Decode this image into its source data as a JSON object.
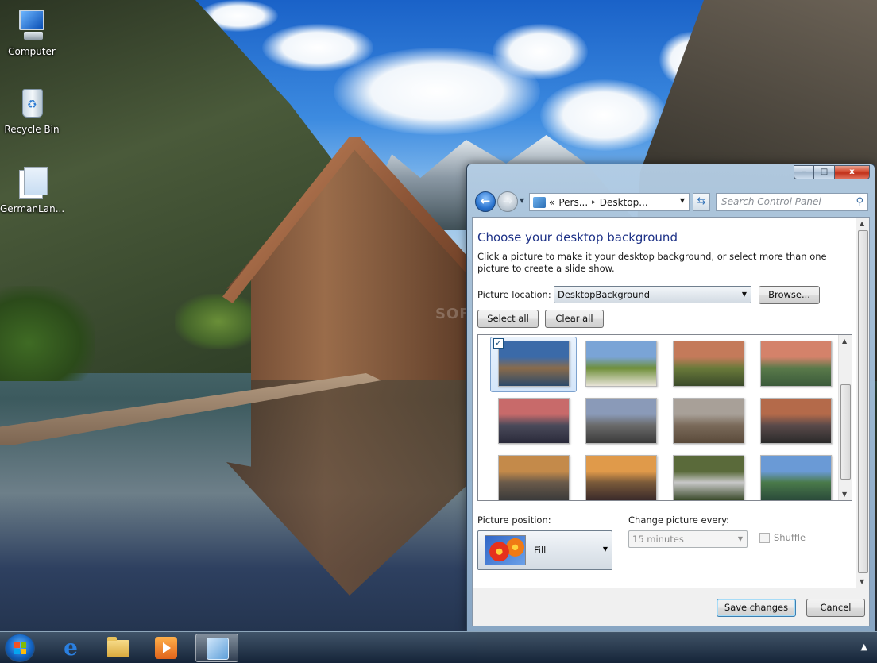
{
  "desktop": {
    "icons": [
      {
        "label": "Computer"
      },
      {
        "label": "Recycle Bin"
      },
      {
        "label": "GermanLan..."
      }
    ]
  },
  "window": {
    "caption": {
      "minimize": "–",
      "maximize": "□",
      "close": "x"
    },
    "address": {
      "crumbs": [
        "«",
        "Pers...",
        "Desktop..."
      ],
      "separator": "▸"
    },
    "search_placeholder": "Search Control Panel",
    "title": "Choose your desktop background",
    "description": "Click a picture to make it your desktop background, or select more than one picture to create a slide show.",
    "picture_location_label": "Picture location:",
    "picture_location_value": "DesktopBackground",
    "browse_label": "Browse...",
    "select_all_label": "Select all",
    "clear_all_label": "Clear all",
    "thumbnails": [
      {
        "name": "boathouse-lake",
        "selected": true,
        "colors": [
          "#3b6aa8",
          "#8a6b4a",
          "#2c4a6a"
        ]
      },
      {
        "name": "sheep-meadow",
        "selected": false,
        "colors": [
          "#7aa4d6",
          "#6f8f3a",
          "#e8e4d8"
        ]
      },
      {
        "name": "lighthouse-field",
        "selected": false,
        "colors": [
          "#c47a5a",
          "#6a7a3a",
          "#3a4a2a"
        ]
      },
      {
        "name": "sunset-stream",
        "selected": false,
        "colors": [
          "#d4826a",
          "#5a7a4a",
          "#3a5a3a"
        ]
      },
      {
        "name": "dusk-shore",
        "selected": false,
        "colors": [
          "#c86a6a",
          "#4a4a5a",
          "#2a2a3a"
        ]
      },
      {
        "name": "rocky-beach",
        "selected": false,
        "colors": [
          "#8a9ab8",
          "#6a6a6a",
          "#3a3a3a"
        ]
      },
      {
        "name": "beach-reflection",
        "selected": false,
        "colors": [
          "#a8a098",
          "#7a6a5a",
          "#5a4a3a"
        ]
      },
      {
        "name": "evening-rocks",
        "selected": false,
        "colors": [
          "#b46a4a",
          "#5a4a4a",
          "#2a2a2a"
        ]
      },
      {
        "name": "golden-coast",
        "selected": false,
        "colors": [
          "#c48a4a",
          "#6a5a4a",
          "#3a3a3a"
        ]
      },
      {
        "name": "sunrise-pebbles",
        "selected": false,
        "colors": [
          "#e09a4a",
          "#7a5a3a",
          "#3a2a2a"
        ]
      },
      {
        "name": "waterfall",
        "selected": false,
        "colors": [
          "#5a6a3a",
          "#c8c8c8",
          "#3a4a2a"
        ]
      },
      {
        "name": "alpine-church",
        "selected": false,
        "colors": [
          "#6a9ad6",
          "#4a7a4a",
          "#2a4a3a"
        ]
      }
    ],
    "picture_position_label": "Picture position:",
    "picture_position_value": "Fill",
    "change_every_label": "Change picture every:",
    "change_every_value": "15 minutes",
    "shuffle_label": "Shuffle",
    "save_label": "Save changes",
    "cancel_label": "Cancel"
  },
  "taskbar": {
    "items": [
      "start-orb",
      "internet-explorer",
      "windows-explorer",
      "media-player",
      "control-panel"
    ],
    "active": "control-panel"
  },
  "colors": {
    "title_blue": "#1e3287",
    "taskbar_dark": "#14233a"
  }
}
